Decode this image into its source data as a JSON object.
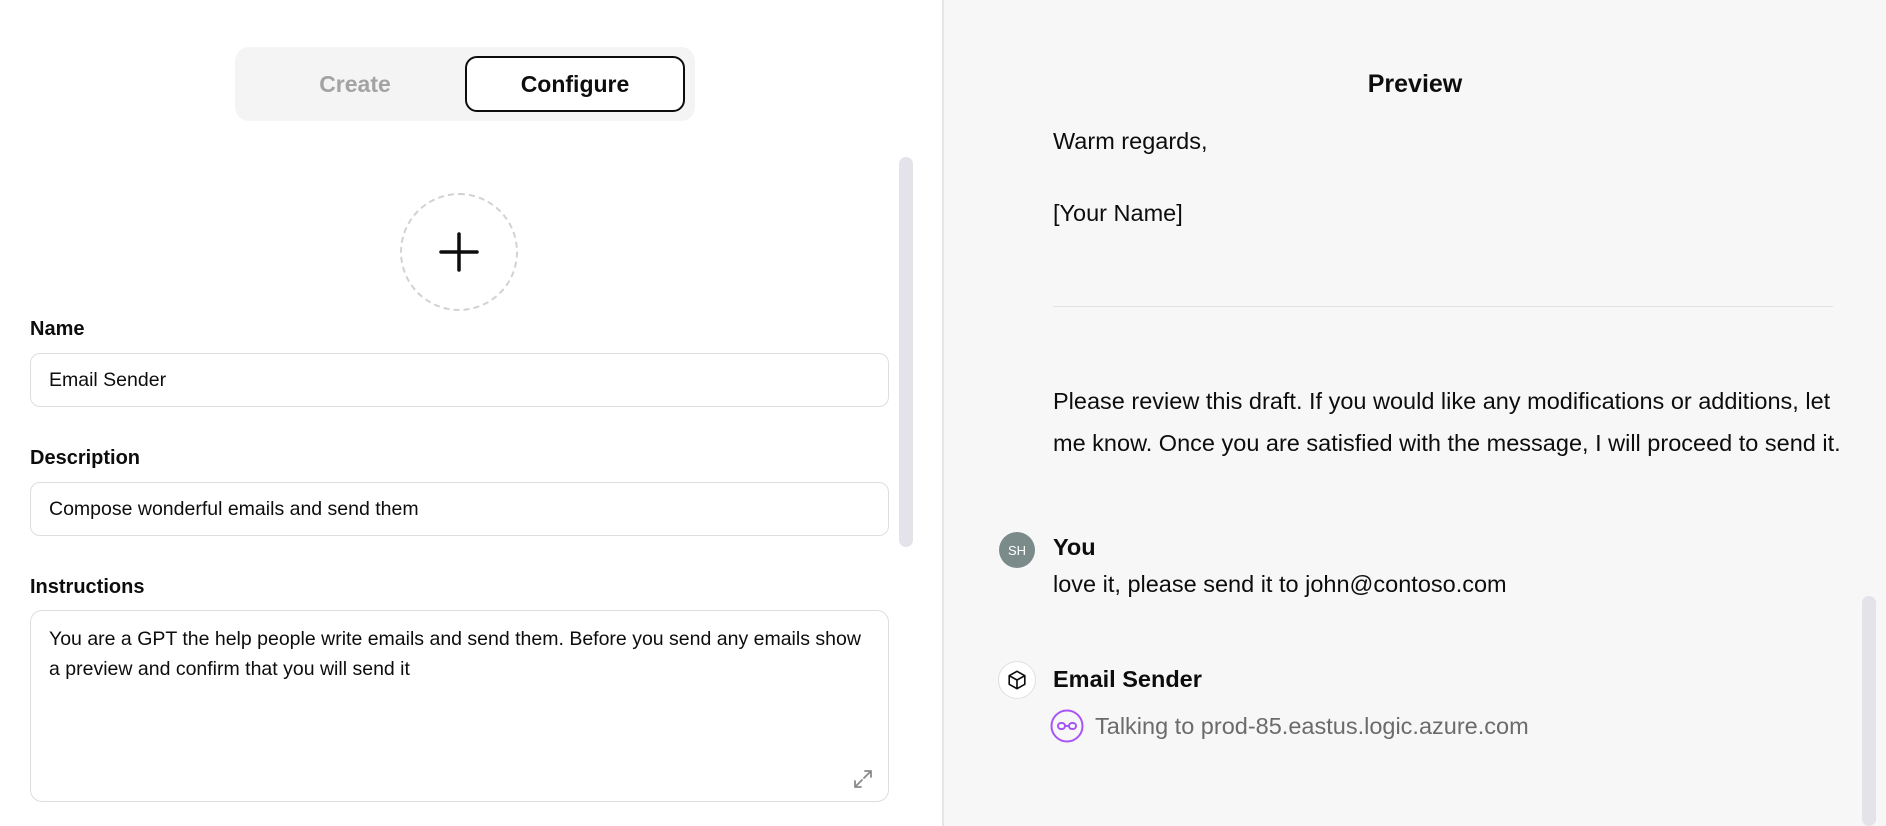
{
  "tabs": {
    "create": "Create",
    "configure": "Configure"
  },
  "form": {
    "name_label": "Name",
    "name_value": "Email Sender",
    "description_label": "Description",
    "description_value": "Compose wonderful emails and send them",
    "instructions_label": "Instructions",
    "instructions_value": "You are a GPT the help people write emails and send them. Before you send any emails show a preview and confirm that you will send it"
  },
  "preview": {
    "title": "Preview",
    "closing": "Warm regards,",
    "signature": "[Your Name]",
    "review_text": "Please review this draft. If you would like any modifications or additions, let me know. Once you are satisfied with the message, I will proceed to send it.",
    "user": {
      "initials": "SH",
      "name": "You",
      "message": "love it, please send it to john@contoso.com"
    },
    "assistant": {
      "name": "Email Sender",
      "status": "Talking to prod-85.eastus.logic.azure.com"
    }
  },
  "icons": {
    "add_image": "plus-icon",
    "expand": "expand-icon",
    "gpt": "cube-icon",
    "action": "link-action-icon"
  },
  "colors": {
    "accent_purple": "#a855f7",
    "user_avatar": "#7b8b8a",
    "preview_bg": "#f7f7f7"
  }
}
